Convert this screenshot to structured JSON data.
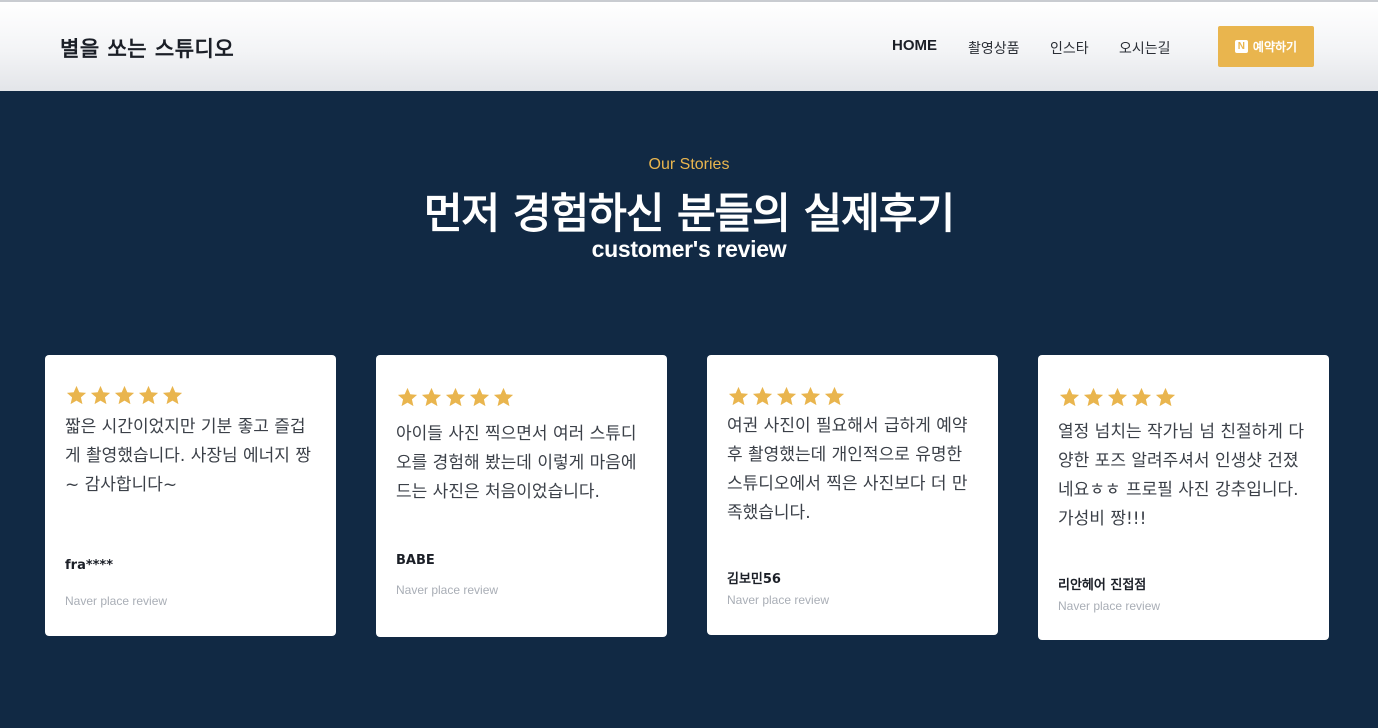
{
  "header": {
    "logo": "별을 쏘는 스튜디오",
    "nav": [
      "HOME",
      "촬영상품",
      "인스타",
      "오시는길"
    ],
    "cta_icon": "N",
    "cta_label": "예약하기"
  },
  "section": {
    "eyebrow": "Our Stories",
    "title": "먼저 경험하신 분들의 실제후기",
    "subtitle": "customer's review"
  },
  "reviews": [
    {
      "rating": 5,
      "text": "짧은 시간이었지만 기분 좋고 즐겁게 촬영했습니다. 사장님 에너지 짱~ 감사합니다~",
      "author": "fra****",
      "source": "Naver place review"
    },
    {
      "rating": 5,
      "text": "아이들 사진 찍으면서 여러 스튜디오를 경험해 봤는데 이렇게 마음에 드는 사진은 처음이었습니다.",
      "author": "BABE",
      "source": "Naver place review"
    },
    {
      "rating": 5,
      "text": "여권 사진이 필요해서 급하게 예약 후 촬영했는데 개인적으로 유명한 스튜디오에서 찍은 사진보다 더 만족했습니다.",
      "author": "김보민56",
      "source": "Naver place review"
    },
    {
      "rating": 5,
      "text": "열정 넘치는 작가님 넘 친절하게 다양한 포즈 알려주셔서 인생샷 건졌네요ㅎㅎ 프로필 사진 강추입니다. 가성비 짱!!!",
      "author": "리안헤어 진접점",
      "source": "Naver place review"
    }
  ],
  "colors": {
    "background": "#112944",
    "accent": "#e9b54e",
    "star": "#e9b54e"
  },
  "icons": {
    "star": "star-icon",
    "naver": "naver-n-icon"
  }
}
